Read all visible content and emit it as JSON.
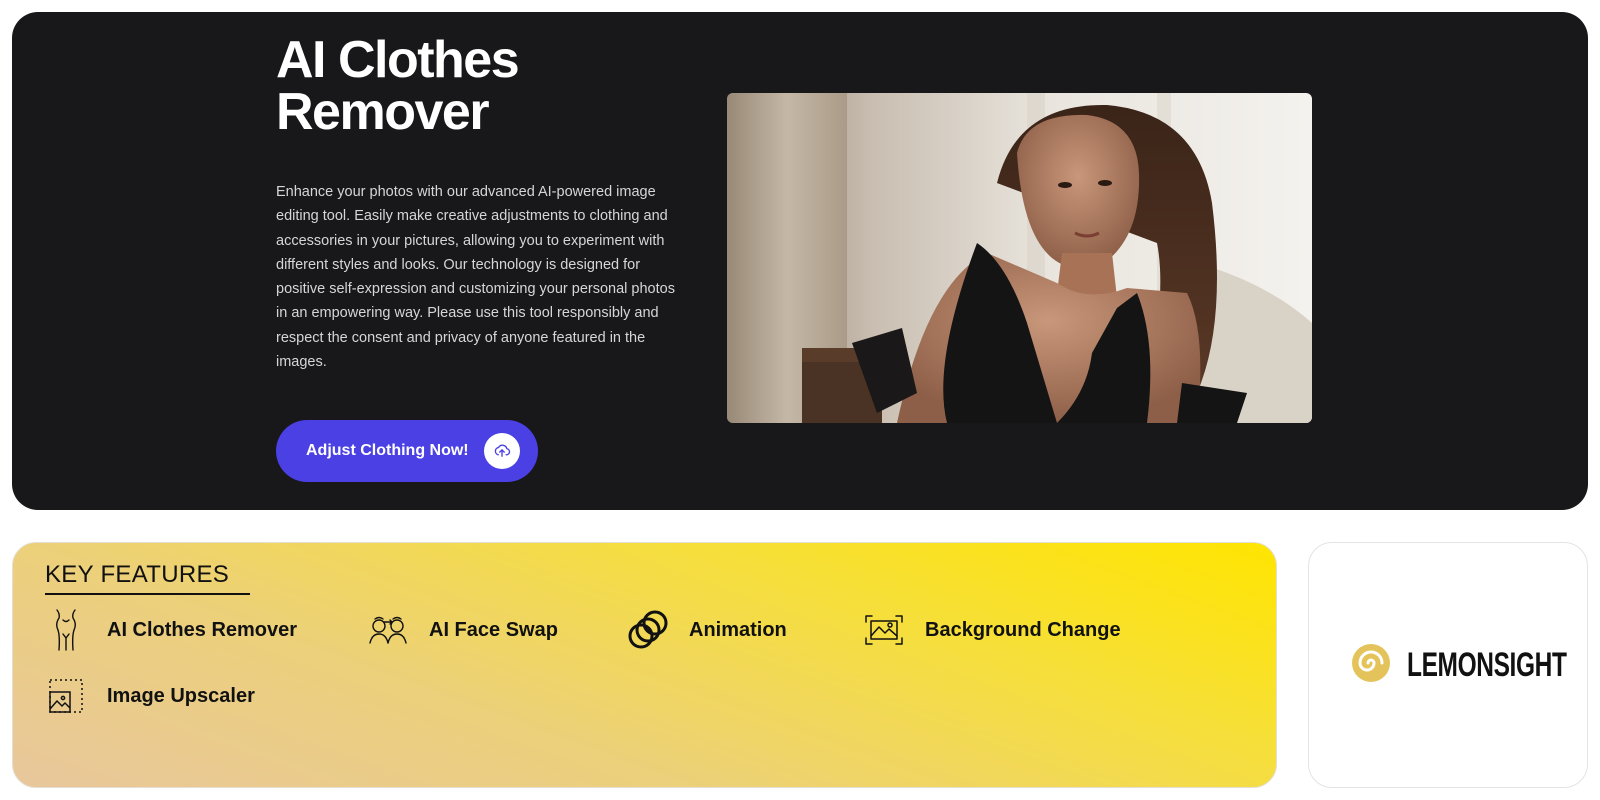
{
  "hero": {
    "title": "AI Clothes Remover",
    "description": "Enhance your photos with our advanced AI-powered image editing tool. Easily make creative adjustments to clothing and accessories in your pictures, allowing you to experiment with different styles and looks. Our technology is designed for positive self-expression and customizing your personal photos in an empowering way. Please use this tool responsibly and respect the consent and privacy of anyone featured in the images.",
    "cta_label": "Adjust Clothing Now!",
    "cta_icon": "upload-icon",
    "photo_icon": "hero-photo"
  },
  "features": {
    "title": "KEY FEATURES",
    "items": [
      {
        "label": "AI Clothes Remover",
        "icon": "body-outline-icon"
      },
      {
        "label": "AI Face Swap",
        "icon": "face-swap-icon"
      },
      {
        "label": "Animation",
        "icon": "animation-rings-icon"
      },
      {
        "label": "Background Change",
        "icon": "background-frame-icon"
      },
      {
        "label": "Image Upscaler",
        "icon": "image-upscaler-icon"
      }
    ]
  },
  "partner": {
    "name": "LEMONSIGHT",
    "icon": "lemon-swirl-icon"
  },
  "colors": {
    "hero_bg": "#18181a",
    "cta_bg": "#4a40e4",
    "features_gradient_start": "#ffe500",
    "features_gradient_end": "#e8c79c",
    "partner_logo_gold": "#e3c35a"
  }
}
